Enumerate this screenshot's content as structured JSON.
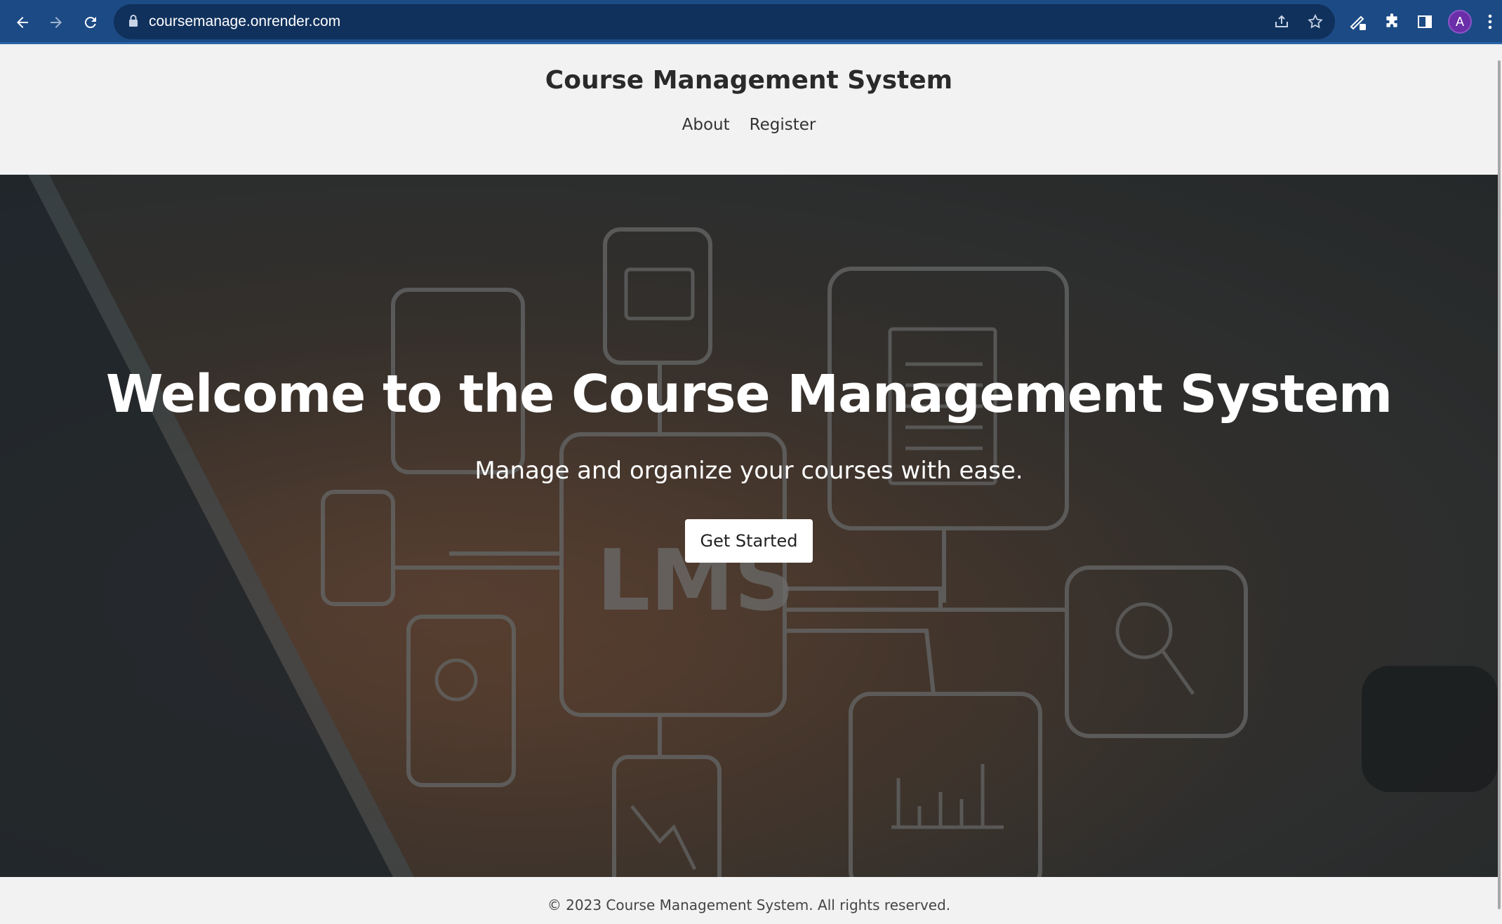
{
  "browser": {
    "url": "coursemanage.onrender.com",
    "profile_initial": "A",
    "icons": {
      "back": "arrow-left-icon",
      "forward": "arrow-right-icon",
      "reload": "reload-icon",
      "lock": "lock-icon",
      "share": "share-icon",
      "bookmark": "star-icon",
      "extension_edit": "pen-icon",
      "extensions": "puzzle-icon",
      "side_panel": "side-panel-icon",
      "menu": "kebab-menu-icon"
    },
    "colors": {
      "toolbar": "#1c4a85",
      "omnibox": "#10315c",
      "avatar": "#6a2ea8"
    }
  },
  "header": {
    "title": "Course Management System",
    "nav": [
      {
        "label": "About"
      },
      {
        "label": "Register"
      }
    ]
  },
  "hero": {
    "title": "Welcome to the Course Management System",
    "subtitle": "Manage and organize your courses with ease.",
    "cta_label": "Get Started",
    "image_watermark_text": "LMS"
  },
  "footer": {
    "text": "© 2023 Course Management System. All rights reserved."
  }
}
